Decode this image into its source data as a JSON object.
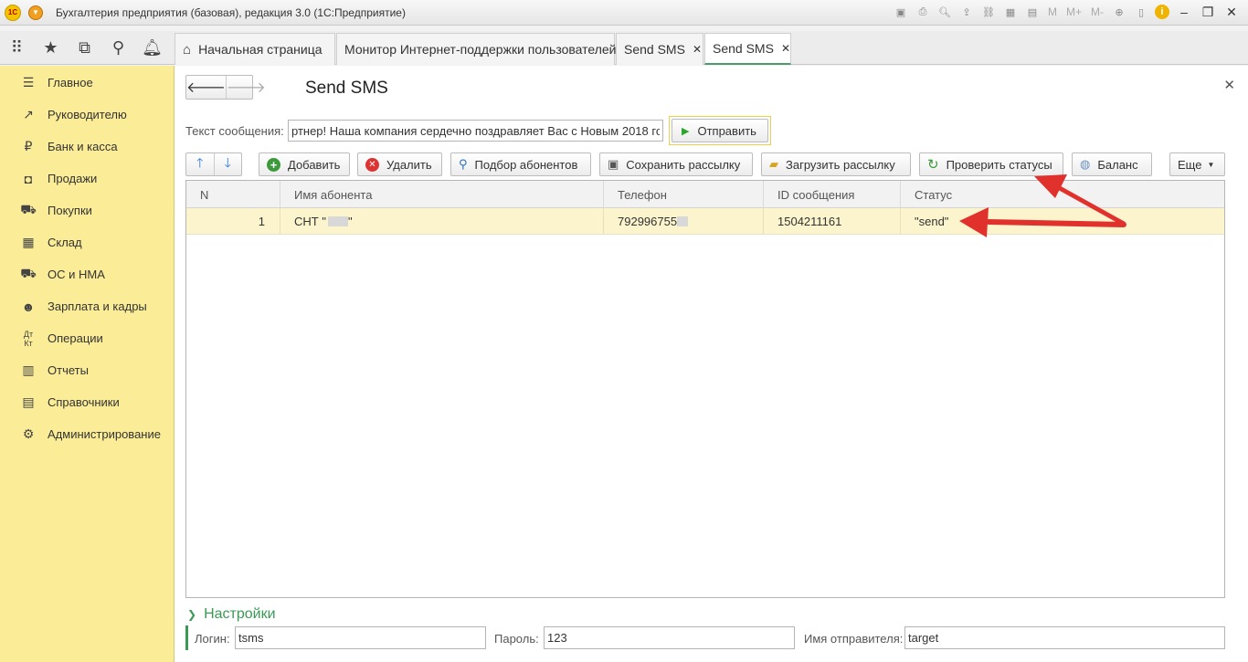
{
  "app": {
    "title": "Бухгалтерия предприятия (базовая), редакция 3.0  (1С:Предприятие)",
    "logo_text": "1С"
  },
  "title_tools": {
    "m": "M",
    "m_plus": "M+",
    "m_minus": "M-"
  },
  "tabs": [
    {
      "label": "Начальная страница",
      "closable": false,
      "active": false
    },
    {
      "label": "Монитор Интернет-поддержки пользователей",
      "closable": true,
      "active": false
    },
    {
      "label": "Send SMS",
      "closable": true,
      "active": false
    },
    {
      "label": "Send SMS",
      "closable": true,
      "active": true
    }
  ],
  "sidebar": {
    "items": [
      {
        "label": "Главное",
        "icon": "menu-lines-icon"
      },
      {
        "label": "Руководителю",
        "icon": "trend-up-icon"
      },
      {
        "label": "Банк и касса",
        "icon": "ruble-coin-icon"
      },
      {
        "label": "Продажи",
        "icon": "shopping-bag-icon"
      },
      {
        "label": "Покупки",
        "icon": "cart-icon"
      },
      {
        "label": "Склад",
        "icon": "warehouse-icon"
      },
      {
        "label": "ОС и НМА",
        "icon": "truck-icon"
      },
      {
        "label": "Зарплата и кадры",
        "icon": "person-icon"
      },
      {
        "label": "Операции",
        "icon": "dt-kt-icon"
      },
      {
        "label": "Отчеты",
        "icon": "bar-chart-icon"
      },
      {
        "label": "Справочники",
        "icon": "book-icon"
      },
      {
        "label": "Администрирование",
        "icon": "gear-icon"
      }
    ]
  },
  "form": {
    "title": "Send SMS",
    "message_label": "Текст сообщения:",
    "message_value": "ртнер! Наша компания сердечно поздравляет Вас с Новым 2018 го",
    "send_label": "Отправить"
  },
  "toolbar": {
    "add": "Добавить",
    "delete": "Удалить",
    "select_subscribers": "Подбор абонентов",
    "save_mailing": "Сохранить рассылку",
    "load_mailing": "Загрузить рассылку",
    "check_statuses": "Проверить статусы",
    "balance": "Баланс",
    "more": "Еще"
  },
  "table": {
    "columns": [
      "N",
      "Имя абонента",
      "Телефон",
      "ID сообщения",
      "Статус"
    ],
    "rows": [
      {
        "n": "1",
        "name": "СНТ \"",
        "name_end": "\"",
        "phone": "792996755",
        "message_id": "1504211161",
        "status": "\"send\""
      }
    ]
  },
  "settings": {
    "title": "Настройки",
    "login_label": "Логин:",
    "login_value": "tsms",
    "password_label": "Пароль:",
    "password_value": "123",
    "sender_label": "Имя отправителя:",
    "sender_value": "target"
  },
  "colors": {
    "sidebar_bg": "#fbec98",
    "accent_green": "#3a9a55",
    "selected_row": "#fbf4cc",
    "annotation_red": "#e0312c"
  }
}
